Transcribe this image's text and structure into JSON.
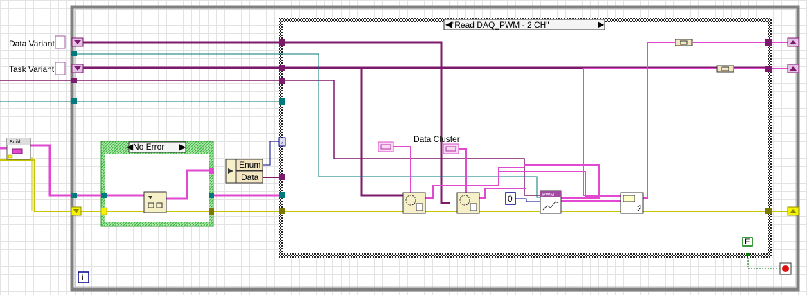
{
  "terminals": {
    "data_variant": "Data Variant",
    "task_variant": "Task Variant"
  },
  "build_array": {
    "label": "Build"
  },
  "no_error_case": {
    "selector": "No Error",
    "arrow": "▾"
  },
  "unbundle": {
    "enum": "Enum",
    "data": "Data"
  },
  "main_case": {
    "selector": "\"Read DAQ_PWM - 2 CH\"",
    "arrow": "▾▴"
  },
  "data_cluster_label": "Data Cluster",
  "constant_zero": "0",
  "channel_count": "2",
  "pwm_node_label": "PWM",
  "stop_constant": "F",
  "loop_iteration": "i",
  "colors": {
    "variant_wire": "#7c1a6b",
    "cluster_wire": "#e049d0",
    "error_wire": "#c8c400",
    "ref_wire": "#007a7a",
    "case_border": "#333333",
    "loop_border": "#808080",
    "no_error_frame": "#48c848"
  }
}
